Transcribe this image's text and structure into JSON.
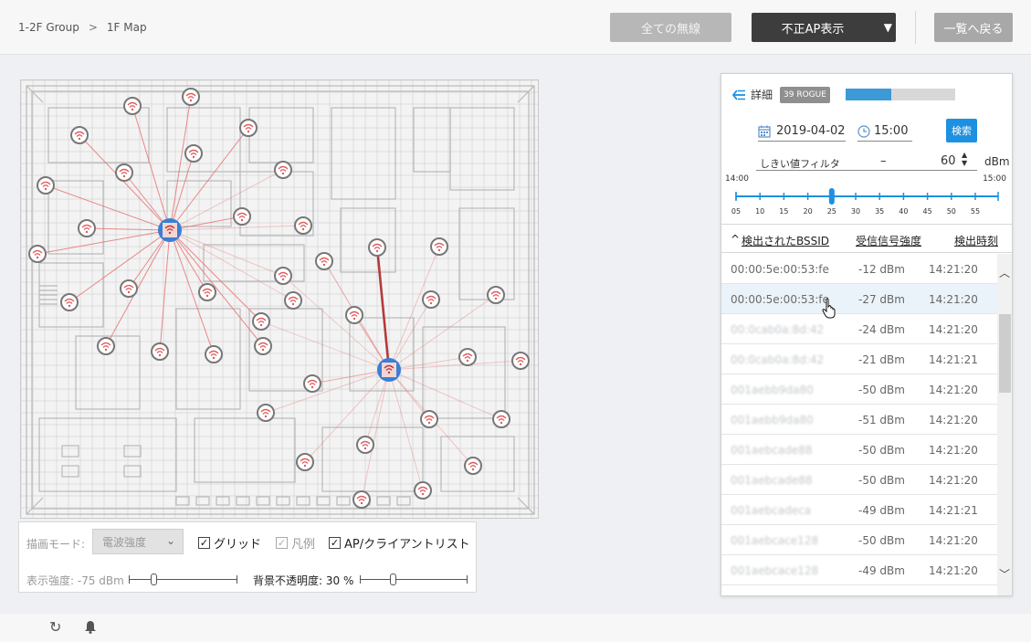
{
  "header": {
    "breadcrumb": [
      "1-2F Group",
      "1F Map"
    ],
    "breadcrumb_sep": ">",
    "btn_all_wireless": "全ての無線",
    "btn_rogue_ap": "不正AP表示",
    "btn_back_list": "一覧へ戻る"
  },
  "controls": {
    "mode_label": "描画モード:",
    "mode_value": "電波強度",
    "grid_label": "グリッド",
    "grid_checked": true,
    "legend_label": "凡例",
    "legend_checked": true,
    "aplist_label": "AP/クライアントリスト",
    "aplist_checked": true,
    "strength_label": "表示強度: -75 dBm",
    "opacity_label": "背景不透明度: 30 %",
    "strength_value_dbm": -75,
    "opacity_percent": 30
  },
  "panel": {
    "detail_label": "詳細",
    "rogue_badge": "39 ROGUE",
    "progress_fraction": 0.42,
    "date": "2019-04-02",
    "time": "15:00",
    "search_btn": "検索",
    "filter_label": "しきい値フィルタ",
    "filter_sign": "–",
    "filter_value": "60",
    "filter_unit": "dBm",
    "time_start": "14:00",
    "time_end": "15:00",
    "timeline_ticks": [
      "05",
      "10",
      "15",
      "20",
      "25",
      "30",
      "35",
      "40",
      "45",
      "50",
      "55"
    ],
    "timeline_selected": "25",
    "col_bssid": "検出されたBSSID",
    "col_signal": "受信信号強度",
    "col_time": "検出時刻",
    "sort_icon": "^",
    "rows": [
      {
        "bssid": "00:00:5e:00:53:fe",
        "signal": "-12 dBm",
        "time": "14:21:20",
        "blur": false
      },
      {
        "bssid": "00:00:5e:00:53:fe",
        "signal": "-27 dBm",
        "time": "14:21:20",
        "blur": false
      },
      {
        "bssid": "00:0cab0a:8d:42",
        "signal": "-24 dBm",
        "time": "14:21:20",
        "blur": true
      },
      {
        "bssid": "00:0cab0a:8d:42",
        "signal": "-21 dBm",
        "time": "14:21:21",
        "blur": true
      },
      {
        "bssid": "001aebb9da80",
        "signal": "-50 dBm",
        "time": "14:21:20",
        "blur": true
      },
      {
        "bssid": "001aebb9da80",
        "signal": "-51 dBm",
        "time": "14:21:20",
        "blur": true
      },
      {
        "bssid": "001aebcade88",
        "signal": "-50 dBm",
        "time": "14:21:20",
        "blur": true
      },
      {
        "bssid": "001aebcade88",
        "signal": "-50 dBm",
        "time": "14:21:20",
        "blur": true
      },
      {
        "bssid": "001aebcadeca",
        "signal": "-49 dBm",
        "time": "14:21:21",
        "blur": true
      },
      {
        "bssid": "001aebcace128",
        "signal": "-50 dBm",
        "time": "14:21:20",
        "blur": true
      },
      {
        "bssid": "001aebcace128",
        "signal": "-49 dBm",
        "time": "14:21:20",
        "blur": true
      }
    ]
  },
  "colors": {
    "accent": "#1e90e0",
    "rogue_line": "#e86e6e",
    "strong_link": "#b53a3a",
    "ap_ring": "#3a7fd6",
    "node_ring": "#777777",
    "node_wifi": "#e15b5b"
  }
}
